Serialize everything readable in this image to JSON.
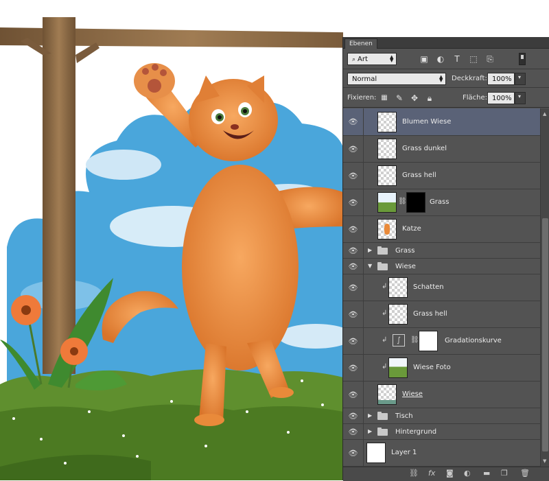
{
  "panel": {
    "tab": "Ebenen",
    "filter": {
      "kind": "Art"
    },
    "blend_mode": "Normal",
    "opacity": {
      "label": "Deckkraft:",
      "value": "100%"
    },
    "lock": {
      "label": "Fixieren:"
    },
    "fill": {
      "label": "Fläche:",
      "value": "100%"
    }
  },
  "layers": [
    {
      "name": "Blumen Wiese",
      "selected": true
    },
    {
      "name": "Grass dunkel"
    },
    {
      "name": "Grass hell"
    },
    {
      "name": "Grass"
    },
    {
      "name": "Katze"
    },
    {
      "name": "Grass"
    },
    {
      "name": "Wiese"
    },
    {
      "name": "Schatten"
    },
    {
      "name": "Grass hell"
    },
    {
      "name": "Gradationskurve"
    },
    {
      "name": "Wiese Foto"
    },
    {
      "name": "Wiese"
    },
    {
      "name": "Tisch"
    },
    {
      "name": "Hintergrund"
    },
    {
      "name": "Layer 1"
    }
  ],
  "colors": {
    "panel_bg": "#535353",
    "selected_row": "#5a6277",
    "sky": "#4aa6db",
    "cat": "#e98a3a",
    "grass": "#5f8f2e",
    "wood": "#8a6a45",
    "flower": "#ef7a3a"
  }
}
